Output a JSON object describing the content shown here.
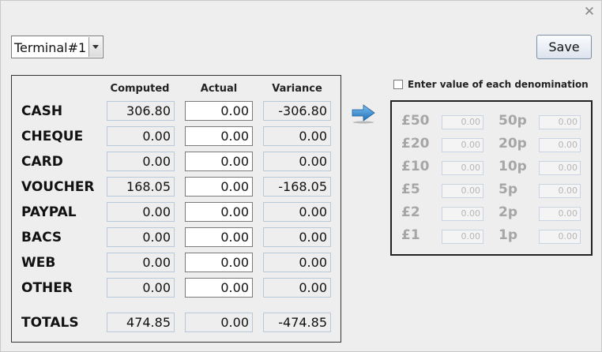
{
  "terminal": {
    "selected": "Terminal#1"
  },
  "toolbar": {
    "save_label": "Save"
  },
  "table": {
    "headers": [
      "Computed",
      "Actual",
      "Variance"
    ],
    "rows": [
      {
        "label": "CASH",
        "computed": "306.80",
        "actual": "0.00",
        "variance": "-306.80"
      },
      {
        "label": "CHEQUE",
        "computed": "0.00",
        "actual": "0.00",
        "variance": "0.00"
      },
      {
        "label": "CARD",
        "computed": "0.00",
        "actual": "0.00",
        "variance": "0.00"
      },
      {
        "label": "VOUCHER",
        "computed": "168.05",
        "actual": "0.00",
        "variance": "-168.05"
      },
      {
        "label": "PAYPAL",
        "computed": "0.00",
        "actual": "0.00",
        "variance": "0.00"
      },
      {
        "label": "BACS",
        "computed": "0.00",
        "actual": "0.00",
        "variance": "0.00"
      },
      {
        "label": "WEB",
        "computed": "0.00",
        "actual": "0.00",
        "variance": "0.00"
      },
      {
        "label": "OTHER",
        "computed": "0.00",
        "actual": "0.00",
        "variance": "0.00"
      }
    ],
    "totals": {
      "label": "TOTALS",
      "computed": "474.85",
      "actual": "0.00",
      "variance": "-474.85"
    }
  },
  "denominations": {
    "checkbox_label": "Enter value of each denomination",
    "left": [
      {
        "label": "£50",
        "value": "0.00"
      },
      {
        "label": "£20",
        "value": "0.00"
      },
      {
        "label": "£10",
        "value": "0.00"
      },
      {
        "label": "£5",
        "value": "0.00"
      },
      {
        "label": "£2",
        "value": "0.00"
      },
      {
        "label": "£1",
        "value": "0.00"
      }
    ],
    "right": [
      {
        "label": "50p",
        "value": "0.00"
      },
      {
        "label": "20p",
        "value": "0.00"
      },
      {
        "label": "10p",
        "value": "0.00"
      },
      {
        "label": "5p",
        "value": "0.00"
      },
      {
        "label": "2p",
        "value": "0.00"
      },
      {
        "label": "1p",
        "value": "0.00"
      }
    ]
  },
  "icons": {
    "close": "close-icon",
    "arrow": "arrow-right-icon",
    "dropdown": "chevron-down-icon"
  },
  "colors": {
    "arrow": "#3a8fd0",
    "disabled_text": "#a6a6a6"
  }
}
